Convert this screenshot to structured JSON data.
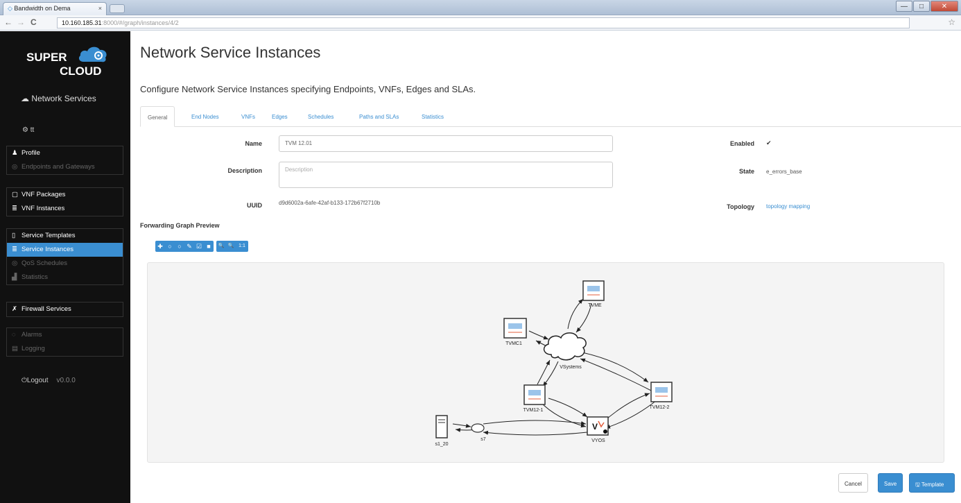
{
  "browser": {
    "tab_title": "Bandwidth on Dema",
    "tab_close": "×",
    "url_host": "10.160.185.31",
    "url_path": ":8000/#/graph/instances/4/2",
    "back": "←",
    "forward": "→",
    "reload": "C",
    "star": "☆",
    "window_buttons": [
      "—",
      "□",
      "✕"
    ]
  },
  "sidebar": {
    "logo_super": "SUPER",
    "logo_cloud": "CLOUD",
    "title": "Network Services",
    "user": "tt",
    "groups": [
      [
        {
          "label": "Profile",
          "icon": "user-icon",
          "glyph": "♟",
          "dim": false,
          "active": false
        },
        {
          "label": "Endpoints and Gateways",
          "icon": "endpoint-icon",
          "glyph": "◎",
          "dim": true,
          "active": false
        }
      ],
      [
        {
          "label": "VNF Packages",
          "icon": "package-icon",
          "glyph": "▢",
          "dim": false,
          "active": false
        },
        {
          "label": "VNF Instances",
          "icon": "list-icon",
          "glyph": "≣",
          "dim": false,
          "active": false
        }
      ],
      [
        {
          "label": "Service Templates",
          "icon": "file-icon",
          "glyph": "▯",
          "dim": false,
          "active": false
        },
        {
          "label": "Service Instances",
          "icon": "list-icon",
          "glyph": "≣",
          "dim": false,
          "active": true
        },
        {
          "label": "QoS Schedules",
          "icon": "schedule-icon",
          "glyph": "◎",
          "dim": true,
          "active": false
        },
        {
          "label": "Statistics",
          "icon": "bar-chart-icon",
          "glyph": "▟",
          "dim": true,
          "active": false
        }
      ],
      [
        {
          "label": "Firewall Services",
          "icon": "firewall-icon",
          "glyph": "✗",
          "dim": false,
          "active": false
        }
      ],
      [
        {
          "label": "Alarms",
          "icon": "alarm-icon",
          "glyph": "◌",
          "dim": true,
          "active": false
        },
        {
          "label": "Logging",
          "icon": "logging-icon",
          "glyph": "▤",
          "dim": true,
          "active": false
        }
      ]
    ],
    "logout": "Logout",
    "version": "v0.0.0"
  },
  "main": {
    "title": "Network Service Instances",
    "subtitle": "Configure Network Service Instances specifying Endpoints, VNFs, Edges and SLAs.",
    "tabs": [
      "General",
      "End Nodes",
      "VNFs",
      "Edges",
      "Schedules",
      "Paths and SLAs",
      "Statistics"
    ],
    "form": {
      "name_label": "Name",
      "name_value": "TVM 12.01",
      "description_label": "Description",
      "description_placeholder": "Description",
      "uuid_label": "UUID",
      "uuid_value": "d9d6002a-6afe-42af-b133-172b67f2710b",
      "enabled_label": "Enabled",
      "enabled_mark": "✔",
      "state_label": "State",
      "state_value": "e_errors_base",
      "topology_label": "Topology",
      "topology_link": "topology mapping"
    },
    "graph_heading": "Forwarding Graph Preview",
    "toolbar_groups": [
      [
        "✚",
        "○",
        "○",
        "✎",
        "☑",
        "■"
      ],
      [
        "🔍",
        "🔍",
        "1:1"
      ]
    ],
    "graph": {
      "nodes": {
        "tvme": "TVME",
        "tvmc": "TVMC1",
        "cloud": "VSystems",
        "tvm1": "TVM12-1",
        "tvm2": "TVM12-2",
        "vyos": "VYOS",
        "s1": "s1_20",
        "s7": "s7"
      }
    },
    "buttons": {
      "cancel": "Cancel",
      "save": "Save",
      "template": "Template"
    }
  }
}
